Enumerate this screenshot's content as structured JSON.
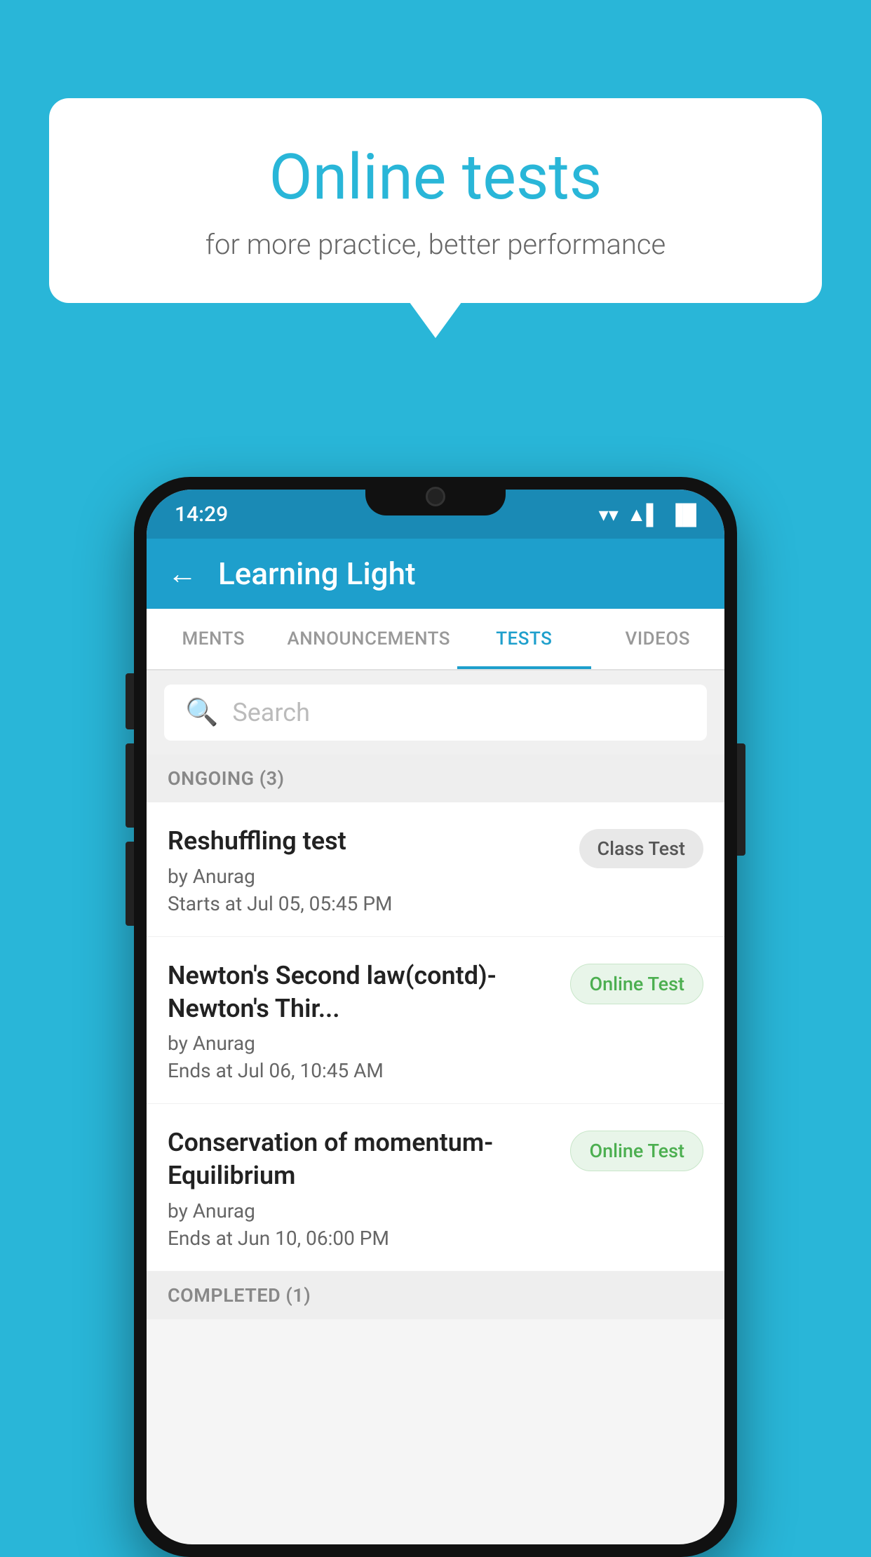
{
  "background_color": "#29b6d8",
  "speech_bubble": {
    "title": "Online tests",
    "subtitle": "for more practice, better performance"
  },
  "status_bar": {
    "time": "14:29",
    "wifi": "▼",
    "signal": "▲",
    "battery": "▌"
  },
  "app_bar": {
    "back_label": "←",
    "title": "Learning Light"
  },
  "tabs": [
    {
      "label": "MENTS",
      "active": false
    },
    {
      "label": "ANNOUNCEMENTS",
      "active": false
    },
    {
      "label": "TESTS",
      "active": true
    },
    {
      "label": "VIDEOS",
      "active": false
    }
  ],
  "search": {
    "placeholder": "Search"
  },
  "ongoing_section": {
    "title": "ONGOING (3)"
  },
  "tests": [
    {
      "name": "Reshuffling test",
      "author": "by Anurag",
      "date": "Starts at  Jul 05, 05:45 PM",
      "badge": "Class Test",
      "badge_type": "class"
    },
    {
      "name": "Newton's Second law(contd)-Newton's Thir...",
      "author": "by Anurag",
      "date": "Ends at  Jul 06, 10:45 AM",
      "badge": "Online Test",
      "badge_type": "online"
    },
    {
      "name": "Conservation of momentum-Equilibrium",
      "author": "by Anurag",
      "date": "Ends at  Jun 10, 06:00 PM",
      "badge": "Online Test",
      "badge_type": "online"
    }
  ],
  "completed_section": {
    "title": "COMPLETED (1)"
  }
}
